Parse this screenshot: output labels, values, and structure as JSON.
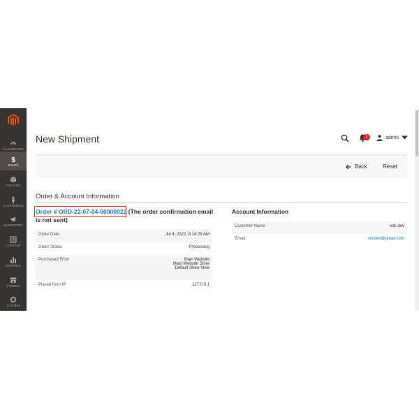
{
  "sidebar": {
    "items": [
      {
        "label": "DASHBOARD",
        "icon": "dashboard-icon"
      },
      {
        "label": "SALES",
        "icon": "dollar-icon",
        "active": true
      },
      {
        "label": "CATALOG",
        "icon": "box-icon"
      },
      {
        "label": "CUSTOMERS",
        "icon": "person-icon"
      },
      {
        "label": "MARKETING",
        "icon": "megaphone-icon"
      },
      {
        "label": "CONTENT",
        "icon": "content-icon"
      },
      {
        "label": "REPORTS",
        "icon": "bar-chart-icon"
      },
      {
        "label": "STORES",
        "icon": "store-icon"
      },
      {
        "label": "SYSTEM",
        "icon": "gear-icon"
      }
    ]
  },
  "header": {
    "title": "New Shipment",
    "notifications_count": "1",
    "user": "admin"
  },
  "actions": {
    "back": "Back",
    "reset": "Reset"
  },
  "section": {
    "title": "Order & Account Information"
  },
  "order": {
    "link": "Order # ORD-22-07-04-00000022",
    "note": " (The order confirmation email is not sent)",
    "rows": [
      {
        "label": "Order Date",
        "value": "Jul 4, 2022, 8:14:29 AM"
      },
      {
        "label": "Order Status",
        "value": "Processing"
      },
      {
        "label": "Purchased From",
        "value_lines": [
          "Main Website",
          "Main Website Store",
          "Default Store View"
        ]
      },
      {
        "label": "Placed from IP",
        "value": "127.0.0.1"
      }
    ]
  },
  "account": {
    "title": "Account Information",
    "rows": [
      {
        "label": "Customer Name",
        "value": "vdc dev"
      },
      {
        "label": "Email",
        "value": "vdcdev@gmail.com"
      }
    ]
  },
  "colors": {
    "sidebar_bg": "#373330",
    "logo_orange": "#eb5202",
    "link_blue": "#1979c3",
    "highlight_red": "#e53935",
    "badge_red": "#e22626"
  }
}
